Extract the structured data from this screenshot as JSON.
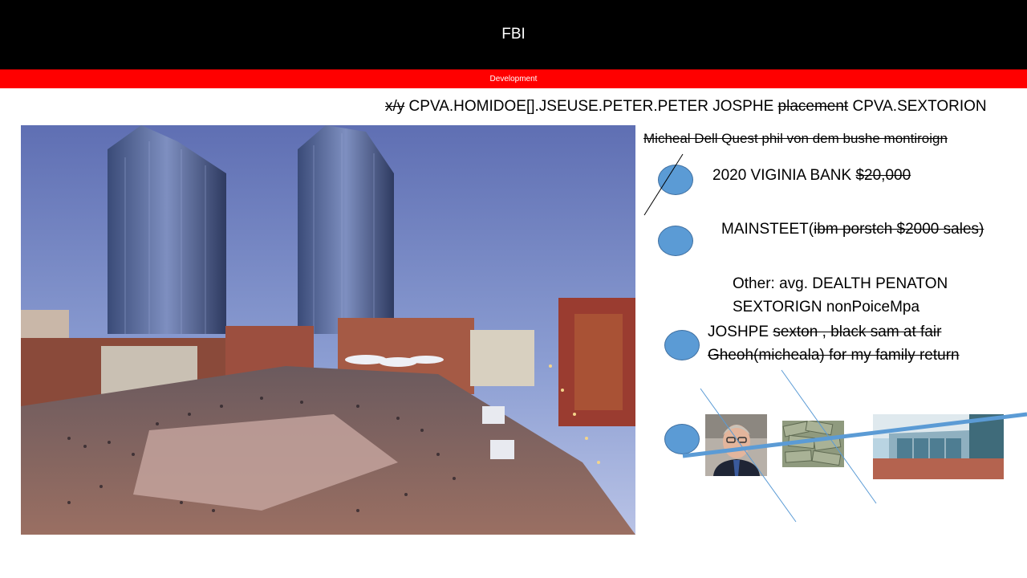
{
  "header": {
    "title": "FBI",
    "subtitle": "Development"
  },
  "top_line": {
    "struck1": "x/y",
    "part1": " CPVA.HOMIDOE[].JSEUSE.PETER.PETER JOSPHE ",
    "struck2": "placement",
    "part2": " CPVA.SEXTORION"
  },
  "subheading": "Micheal Dell Quest phil von dem bushe montiroign",
  "items": [
    {
      "text": "2020 VIGINIA BANK ",
      "struck": "$20,000"
    },
    {
      "text": "MAINSTEET(",
      "struck": "ibm porstch $2000 sales)"
    },
    {
      "line1": "Other: avg. DEALTH PENATON",
      "line2": "SEXTORIGN nonPoiceMpa"
    },
    {
      "text": "JOSHPE ",
      "struck1": "sexton , black sam at fair",
      "struck2": "Gheoh(micheala) for  my family return"
    }
  ],
  "colors": {
    "title_bg": "#000000",
    "bar_red": "#ff0000",
    "dot": "#5b9bd5",
    "line_blue": "#5b9bd5"
  },
  "icons": [
    "plaza-photo",
    "portrait-photo",
    "money-photo",
    "storefront-photo"
  ]
}
